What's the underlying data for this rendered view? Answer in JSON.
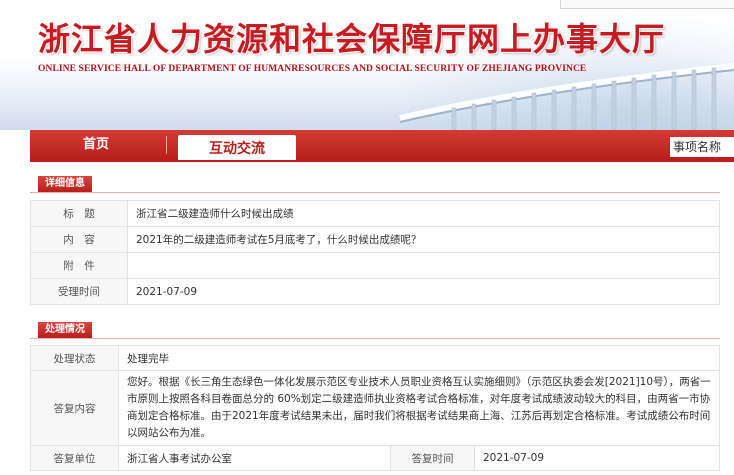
{
  "header": {
    "site_title": "浙江省人力资源和社会保障厅网上办事大厅",
    "site_subtitle": "ONLINE SERVICE HALL OF DEPARTMENT OF HUMANRESOURCES AND SOCIAL SECURITY OF ZHEJIANG PROVINCE"
  },
  "nav": {
    "home": "首页",
    "active_tab": "互动交流",
    "search_label": "事项名称"
  },
  "details": {
    "section_title": "详细信息",
    "rows": [
      {
        "label": "标　题",
        "value": "浙江省二级建造师什么时候出成绩"
      },
      {
        "label": "内　容",
        "value": "2021年的二级建造师考试在5月底考了，什么时候出成绩呢？"
      },
      {
        "label": "附　件",
        "value": ""
      },
      {
        "label": "受理时间",
        "value": "2021-07-09"
      }
    ]
  },
  "processing": {
    "section_title": "处理情况",
    "status_label": "处理状态",
    "status_value": "处理完毕",
    "reply_label": "答复内容",
    "reply_value": "您好。根据《长三角生态绿色一体化发展示范区专业技术人员职业资格互认实施细则》（示范区执委会发[2021]10号），两省一市原则上按照各科目卷面总分的 60%划定二级建造师执业资格考试合格标准，对年度考试成绩波动较大的科目，由两省一市协商划定合格标准。由于2021年度考试结果未出，届时我们将根据考试结果商上海、江苏后再划定合格标准。考试成绩公布时间以网站公布为准。",
    "unit_label": "答复单位",
    "unit_value": "浙江省人事考试办公室",
    "time_label": "答复时间",
    "time_value": "2021-07-09"
  }
}
